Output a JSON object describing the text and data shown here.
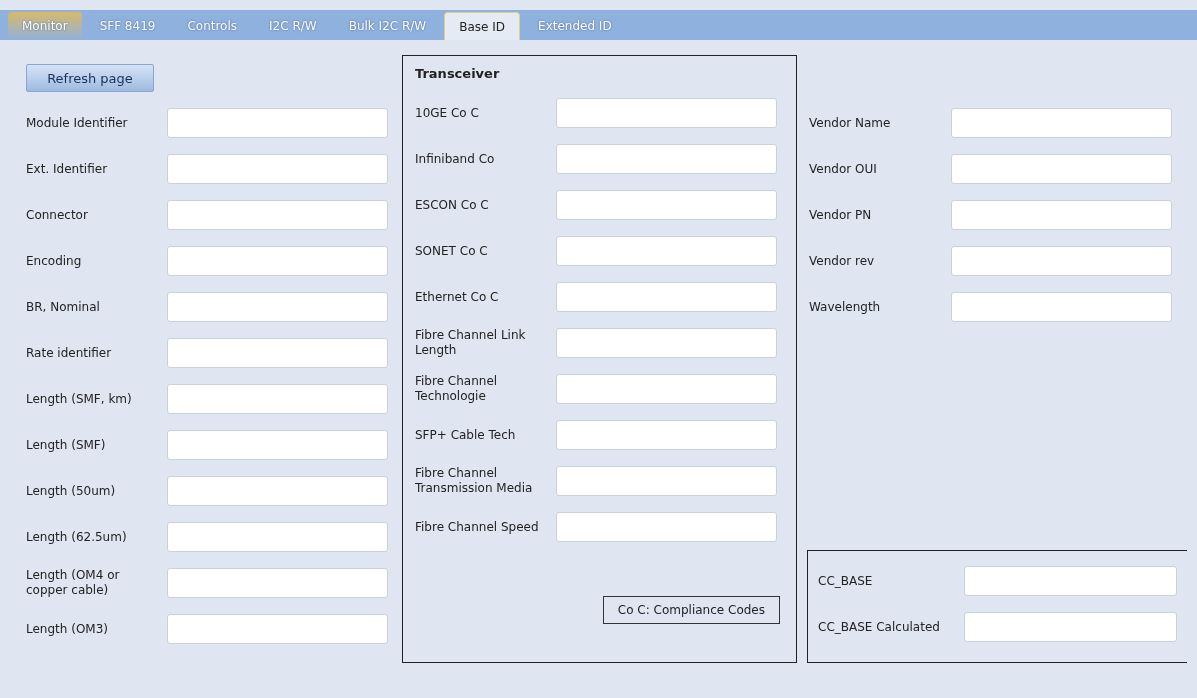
{
  "tabs": [
    {
      "label": "Monitor",
      "selected": false,
      "highlighted": true
    },
    {
      "label": "SFF 8419",
      "selected": false,
      "highlighted": false
    },
    {
      "label": "Controls",
      "selected": false,
      "highlighted": false
    },
    {
      "label": "I2C R/W",
      "selected": false,
      "highlighted": false
    },
    {
      "label": "Bulk I2C R/W",
      "selected": false,
      "highlighted": false
    },
    {
      "label": "Base ID",
      "selected": true,
      "highlighted": false
    },
    {
      "label": "Extended ID",
      "selected": false,
      "highlighted": false
    }
  ],
  "refresh_button": "Refresh page",
  "left_fields": [
    {
      "label": "Module Identifier"
    },
    {
      "label": "Ext. Identifier"
    },
    {
      "label": "Connector"
    },
    {
      "label": "Encoding"
    },
    {
      "label": "BR, Nominal"
    },
    {
      "label": "Rate identifier"
    },
    {
      "label": "Length (SMF, km)"
    },
    {
      "label": "Length (SMF)"
    },
    {
      "label": "Length (50um)"
    },
    {
      "label": "Length (62.5um)"
    },
    {
      "label": "Length (OM4 or copper cable)"
    },
    {
      "label": "Length (OM3)"
    }
  ],
  "transceiver": {
    "title": "Transceiver",
    "fields": [
      {
        "label": "10GE Co C"
      },
      {
        "label": "Infiniband Co"
      },
      {
        "label": "ESCON Co C"
      },
      {
        "label": "SONET Co C"
      },
      {
        "label": "Ethernet Co C"
      },
      {
        "label": "Fibre Channel Link Length"
      },
      {
        "label": "Fibre Channel Technologie"
      },
      {
        "label": "SFP+ Cable Tech"
      },
      {
        "label": "Fibre Channel Transmission Media"
      },
      {
        "label": "Fibre Channel Speed"
      }
    ],
    "note": "Co C: Compliance Codes"
  },
  "vendor_fields": [
    {
      "label": "Vendor Name"
    },
    {
      "label": "Vendor OUI"
    },
    {
      "label": "Vendor PN"
    },
    {
      "label": "Vendor rev"
    },
    {
      "label": "Wavelength"
    }
  ],
  "cc_fields": [
    {
      "label": "CC_BASE"
    },
    {
      "label": "CC_BASE Calculated"
    }
  ]
}
